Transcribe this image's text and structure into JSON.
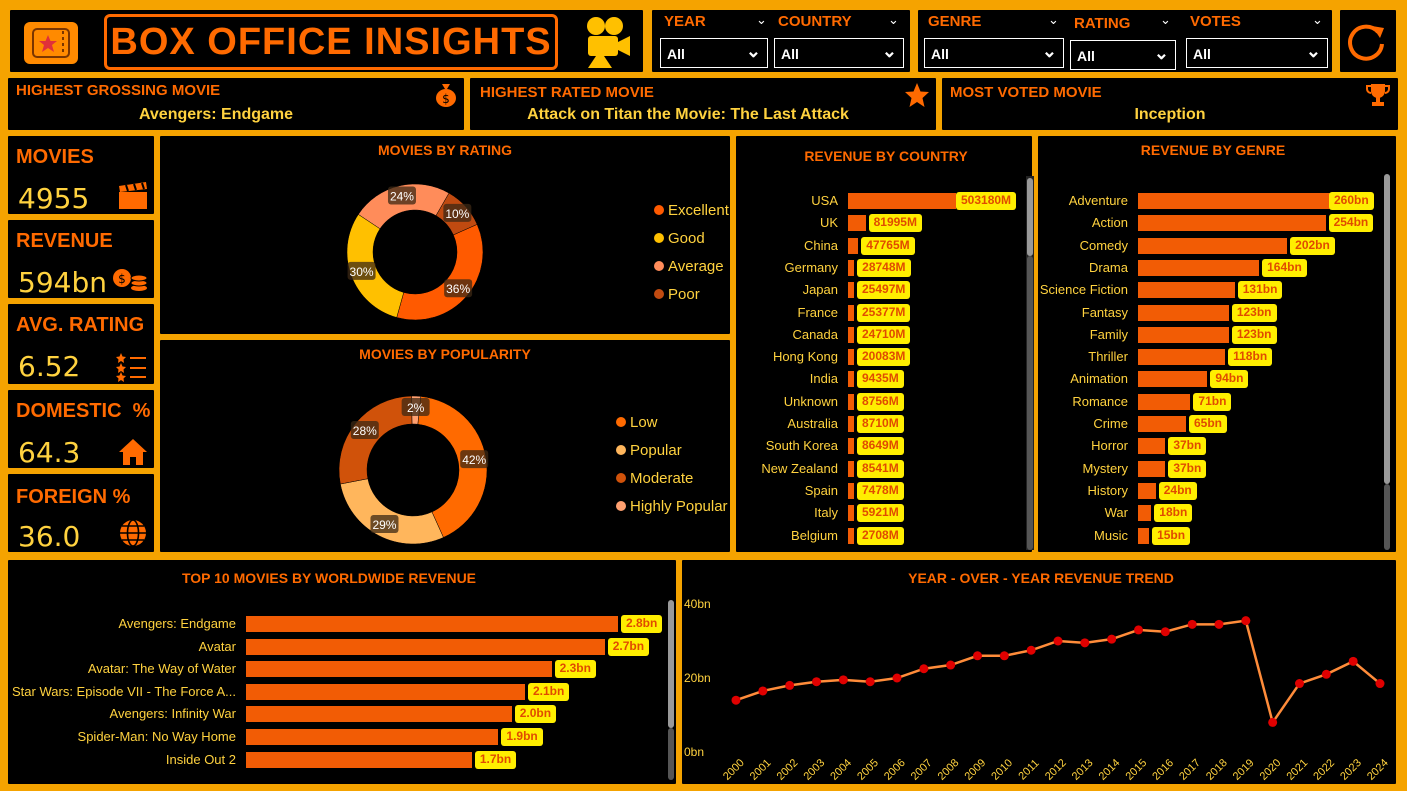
{
  "header": {
    "title": "BOX OFFICE INSIGHTS",
    "ticket_icon": "ticket-star-icon",
    "camera_icon": "movie-camera-icon",
    "refresh_icon": "refresh-icon"
  },
  "filters": [
    {
      "label": "YEAR",
      "value": "All"
    },
    {
      "label": "COUNTRY",
      "value": "All"
    },
    {
      "label": "GENRE",
      "value": "All"
    },
    {
      "label": "RATING",
      "value": "All"
    },
    {
      "label": "VOTES",
      "value": "All"
    }
  ],
  "highlights": {
    "grossing": {
      "label": "HIGHEST GROSSING MOVIE",
      "value": "Avengers: Endgame",
      "icon": "money-bag-icon"
    },
    "rated": {
      "label": "HIGHEST RATED MOVIE",
      "value": "Attack on Titan the Movie: The Last Attack",
      "icon": "star-icon"
    },
    "voted": {
      "label": "MOST VOTED MOVIE",
      "value": "Inception",
      "icon": "trophy-icon"
    }
  },
  "kpis": {
    "movies": {
      "label": "MOVIES",
      "value": "4955",
      "icon": "clapperboard-icon"
    },
    "revenue": {
      "label": "REVENUE",
      "value": "594bn",
      "icon": "coins-icon"
    },
    "rating": {
      "label": "AVG. RATING",
      "value": "6.52",
      "icon": "rating-list-icon"
    },
    "domestic": {
      "label": "DOMESTIC  %",
      "value": "64.3",
      "icon": "home-icon"
    },
    "foreign": {
      "label": "FOREIGN %",
      "value": "36.0",
      "icon": "globe-icon"
    }
  },
  "colors": {
    "accent": "#ff6a00",
    "bar": "#f25c05",
    "label_bg": "#ffee00",
    "frame": "#f5a300",
    "value": "#ffd23f"
  },
  "chart_data": [
    {
      "id": "rating",
      "type": "pie",
      "title": "MOVIES BY RATING",
      "labels": [
        "Excellent",
        "Good",
        "Average",
        "Poor"
      ],
      "values": [
        36,
        30,
        24,
        10
      ],
      "value_labels": [
        "36%",
        "30%",
        "24%",
        "10%"
      ],
      "colors": [
        "#ff5a00",
        "#ffc000",
        "#ff8c5a",
        "#c04a10"
      ],
      "legend": "right"
    },
    {
      "id": "popularity",
      "type": "pie",
      "title": "MOVIES BY POPULARITY",
      "labels": [
        "Low",
        "Popular",
        "Moderate",
        "Highly Popular"
      ],
      "values": [
        42,
        29,
        28,
        2
      ],
      "value_labels": [
        "42%",
        "29%",
        "28%",
        "2%"
      ],
      "colors": [
        "#ff6a00",
        "#ffb65c",
        "#d0520a",
        "#ffa070"
      ],
      "legend": "right"
    },
    {
      "id": "country",
      "type": "bar",
      "title": "REVENUE BY COUNTRY",
      "categories": [
        "USA",
        "UK",
        "China",
        "Germany",
        "Japan",
        "France",
        "Canada",
        "Hong Kong",
        "India",
        "Unknown",
        "Australia",
        "South Korea",
        "New Zealand",
        "Spain",
        "Italy",
        "Belgium"
      ],
      "values": [
        503180,
        81995,
        47765,
        28748,
        25497,
        25377,
        24710,
        20083,
        9435,
        8756,
        8710,
        8649,
        8541,
        7478,
        5921,
        2708
      ],
      "value_labels": [
        "503180M",
        "81995M",
        "47765M",
        "28748M",
        "25497M",
        "25377M",
        "24710M",
        "20083M",
        "9435M",
        "8756M",
        "8710M",
        "8649M",
        "8541M",
        "7478M",
        "5921M",
        "2708M"
      ]
    },
    {
      "id": "genre",
      "type": "bar",
      "title": "REVENUE BY GENRE",
      "categories": [
        "Adventure",
        "Action",
        "Comedy",
        "Drama",
        "Science Fiction",
        "Fantasy",
        "Family",
        "Thriller",
        "Animation",
        "Romance",
        "Crime",
        "Horror",
        "Mystery",
        "History",
        "War",
        "Music"
      ],
      "values": [
        260,
        254,
        202,
        164,
        131,
        123,
        123,
        118,
        94,
        71,
        65,
        37,
        37,
        24,
        18,
        15
      ],
      "value_labels": [
        "260bn",
        "254bn",
        "202bn",
        "164bn",
        "131bn",
        "123bn",
        "123bn",
        "118bn",
        "94bn",
        "71bn",
        "65bn",
        "37bn",
        "37bn",
        "24bn",
        "18bn",
        "15bn"
      ]
    },
    {
      "id": "top10",
      "type": "bar",
      "title": "TOP 10 MOVIES BY WORLDWIDE REVENUE",
      "categories": [
        "Avengers: Endgame",
        "Avatar",
        "Avatar: The Way of Water",
        "Star Wars: Episode VII - The Force A...",
        "Avengers: Infinity War",
        "Spider-Man: No Way Home",
        "Inside Out 2"
      ],
      "values": [
        2.8,
        2.7,
        2.3,
        2.1,
        2.0,
        1.9,
        1.7
      ],
      "value_labels": [
        "2.8bn",
        "2.7bn",
        "2.3bn",
        "2.1bn",
        "2.0bn",
        "1.9bn",
        "1.7bn"
      ]
    },
    {
      "id": "trend",
      "type": "line",
      "title": "YEAR - OVER - YEAR REVENUE TREND",
      "x": [
        "2000",
        "2001",
        "2002",
        "2003",
        "2004",
        "2005",
        "2006",
        "2007",
        "2008",
        "2009",
        "2010",
        "2011",
        "2012",
        "2013",
        "2014",
        "2015",
        "2016",
        "2017",
        "2018",
        "2019",
        "2020",
        "2021",
        "2022",
        "2023",
        "2024"
      ],
      "y": [
        14,
        16.5,
        18,
        19,
        19.5,
        19,
        20,
        22.5,
        23.5,
        26,
        26,
        27.5,
        30,
        29.5,
        30.5,
        33,
        32.5,
        34.5,
        34.5,
        35.5,
        8,
        18.5,
        21,
        24.5,
        18.5
      ],
      "yticks": [
        "0bn",
        "20bn",
        "40bn"
      ],
      "ylim": [
        0,
        40
      ],
      "line_color": "#ff8c3a",
      "marker_color": "#e00000"
    }
  ]
}
